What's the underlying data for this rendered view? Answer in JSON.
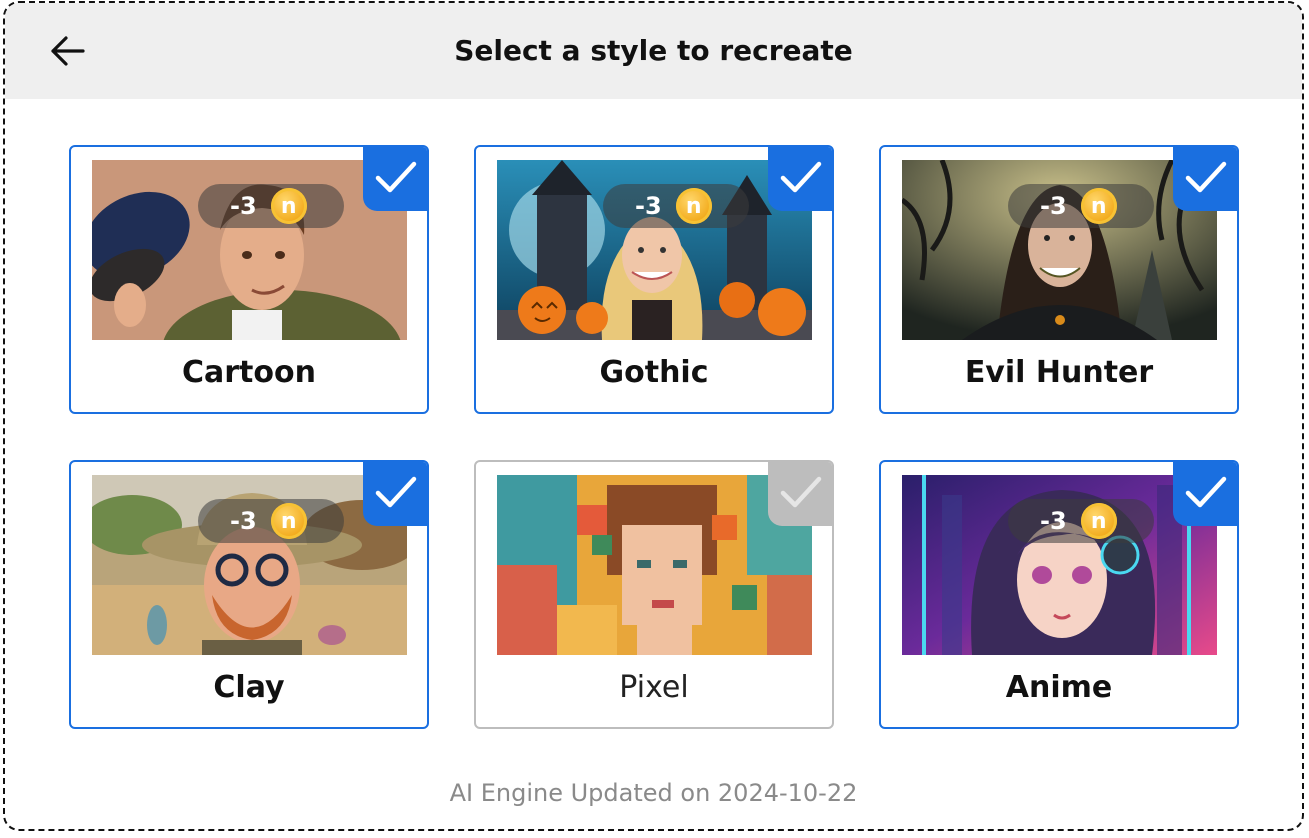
{
  "header": {
    "title": "Select a style to recreate",
    "back_icon": "arrow-left-icon"
  },
  "styles": [
    {
      "label": "Cartoon",
      "cost": "-3",
      "coin_letter": "n",
      "selected": true
    },
    {
      "label": "Gothic",
      "cost": "-3",
      "coin_letter": "n",
      "selected": true
    },
    {
      "label": "Evil Hunter",
      "cost": "-3",
      "coin_letter": "n",
      "selected": true
    },
    {
      "label": "Clay",
      "cost": "-3",
      "coin_letter": "n",
      "selected": true
    },
    {
      "label": "Pixel",
      "selected": false
    },
    {
      "label": "Anime",
      "cost": "-3",
      "coin_letter": "n",
      "selected": true
    }
  ],
  "footer": {
    "text": "AI Engine Updated on 2024-10-22"
  },
  "colors": {
    "accent": "#1a6fe0",
    "unselected": "#bdbdbd",
    "header_bg": "#efefef"
  }
}
